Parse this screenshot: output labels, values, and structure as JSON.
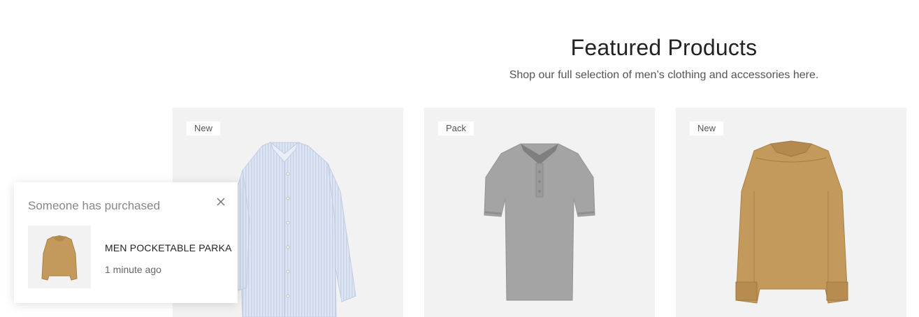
{
  "section": {
    "title": "Featured Products",
    "subtitle": "Shop our full selection of men’s clothing and accessories here."
  },
  "products": [
    {
      "badge": "New",
      "image": "light-blue-oxford-shirt",
      "color": "#d9e3f2"
    },
    {
      "badge": "Pack",
      "image": "grey-polo-shirt",
      "color": "#a3a3a3"
    },
    {
      "badge": "New",
      "image": "tan-overshirt-jacket",
      "color": "#c49a5c"
    }
  ],
  "popup": {
    "title": "Someone has purchased",
    "product_name": "MEN POCKETABLE PARKA",
    "time_ago": "1 minute ago",
    "close_icon": "close-icon",
    "thumb_image": "tan-overshirt-jacket"
  }
}
